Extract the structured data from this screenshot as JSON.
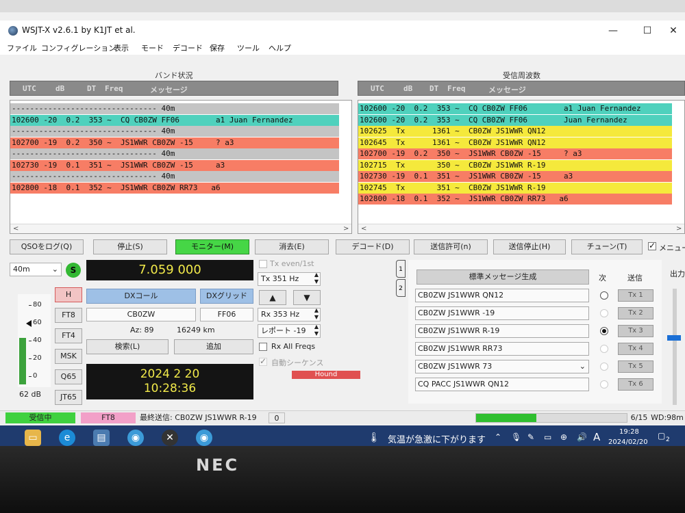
{
  "window": {
    "title": "WSJT-X  v2.6.1  by K1JT et al.",
    "controls": {
      "minimize": "—",
      "maximize": "☐",
      "close": "✕"
    }
  },
  "menu": [
    "ファイル",
    "コンフィグレーション",
    "表示",
    "モード",
    "デコード",
    "保存",
    "ツール",
    "ヘルプ"
  ],
  "band_activity": {
    "title": "バンド状況",
    "headers": [
      "UTC",
      "dB",
      "DT",
      "Freq",
      "メッセージ"
    ],
    "rows": [
      {
        "text": "-------------------------------- 40m",
        "style": "sep"
      },
      {
        "text": "102600 -20  0.2  353 ~  CQ CB0ZW FF06        a1 Juan Fernandez",
        "style": "cq"
      },
      {
        "text": "-------------------------------- 40m",
        "style": "sep"
      },
      {
        "text": "102700 -19  0.2  350 ~  JS1WWR CB0ZW -15     ? a3",
        "style": "rx"
      },
      {
        "text": "-------------------------------- 40m",
        "style": "sep"
      },
      {
        "text": "102730 -19  0.1  351 ~  JS1WWR CB0ZW -15     a3",
        "style": "rx"
      },
      {
        "text": "-------------------------------- 40m",
        "style": "sep"
      },
      {
        "text": "102800 -18  0.1  352 ~  JS1WWR CB0ZW RR73   a6",
        "style": "rx"
      }
    ]
  },
  "rx_frequency": {
    "title": "受信周波数",
    "headers": [
      "UTC",
      "dB",
      "DT",
      "Freq",
      "メッセージ"
    ],
    "rows": [
      {
        "text": "102600 -20  0.2  353 ~  CQ CB0ZW FF06        a1 Juan Fernandez",
        "style": "cq"
      },
      {
        "text": "102600 -20  0.2  353 ~  CQ CB0ZW FF06        Juan Fernandez",
        "style": "cq"
      },
      {
        "text": "102625  Tx      1361 ~  CB0ZW JS1WWR QN12",
        "style": "tx"
      },
      {
        "text": "102645  Tx      1361 ~  CB0ZW JS1WWR QN12",
        "style": "tx"
      },
      {
        "text": "102700 -19  0.2  350 ~  JS1WWR CB0ZW -15     ? a3",
        "style": "rx"
      },
      {
        "text": "102715  Tx       350 ~  CB0ZW JS1WWR R-19",
        "style": "tx"
      },
      {
        "text": "102730 -19  0.1  351 ~  JS1WWR CB0ZW -15     a3",
        "style": "rx"
      },
      {
        "text": "102745  Tx       351 ~  CB0ZW JS1WWR R-19",
        "style": "tx"
      },
      {
        "text": "102800 -18  0.1  352 ~  JS1WWR CB0ZW RR73   a6",
        "style": "rx"
      }
    ]
  },
  "buttons": {
    "log_qso": "QSOをログ(Q)",
    "stop": "停止(S)",
    "monitor": "モニター(M)",
    "erase": "消去(E)",
    "decode": "デコード(D)",
    "enable_tx": "送信許可(n)",
    "halt_tx": "送信停止(H)",
    "tune": "チューン(T)",
    "menus": "メニュー"
  },
  "band": {
    "selected": "40m",
    "s_badge": "S"
  },
  "frequency": "7.059 000",
  "meter": {
    "ticks": [
      "80",
      "60",
      "40",
      "20",
      "0"
    ],
    "level_db": "62 dB",
    "level": 0.55
  },
  "modes": [
    "H",
    "FT8",
    "FT4",
    "MSK",
    "Q65",
    "JT65"
  ],
  "dx": {
    "call_label": "DXコール",
    "grid_label": "DXグリッド",
    "call": "CB0ZW",
    "grid": "FF06",
    "az": "Az: 89",
    "distance": "16249 km",
    "lookup": "検索(L)",
    "add": "追加"
  },
  "clock": {
    "date": "2024 2 20",
    "time": "10:28:36"
  },
  "tx_controls": {
    "tx_even": "Tx even/1st",
    "tx_freq": "Tx  351  Hz",
    "rx_freq": "Rx  353  Hz",
    "report": "レポート -19",
    "rx_all_freqs": "Rx All Freqs",
    "auto_seq": "自動シーケンス",
    "hound": "Hound",
    "up": "▲",
    "down": "▼"
  },
  "messages": {
    "generate": "標準メッセージ生成",
    "next_label": "次",
    "send_label": "送信",
    "tab1": "1",
    "tab2": "2",
    "output_label": "出力",
    "items": [
      {
        "text": "CB0ZW JS1WWR QN12",
        "tx": "Tx 1"
      },
      {
        "text": "CB0ZW JS1WWR -19",
        "tx": "Tx 2"
      },
      {
        "text": "CB0ZW JS1WWR R-19",
        "tx": "Tx 3"
      },
      {
        "text": "CB0ZW JS1WWR RR73",
        "tx": "Tx 4"
      },
      {
        "text": "CB0ZW JS1WWR 73",
        "tx": "Tx 5"
      },
      {
        "text": "CQ PACC JS1WWR QN12",
        "tx": "Tx 6"
      }
    ],
    "selected_next": 2
  },
  "status": {
    "receiving": "受信中",
    "mode": "FT8",
    "last_tx": "最終送信: CB0ZW JS1WWR R-19",
    "counter": "0",
    "progress_fraction": "6/15",
    "wd": "WD:98m",
    "progress": 0.4
  },
  "taskbar": {
    "weather": "気温が急激に下がります",
    "time": "19:28",
    "date": "2024/02/20",
    "ime": "A",
    "notifications": "2"
  },
  "colors": {
    "cq_row": "#4fd1bd",
    "rx_row": "#f77d65",
    "tx_row": "#f5e93c",
    "separator_row": "#c4c4c4",
    "monitor_active": "#46d646"
  }
}
